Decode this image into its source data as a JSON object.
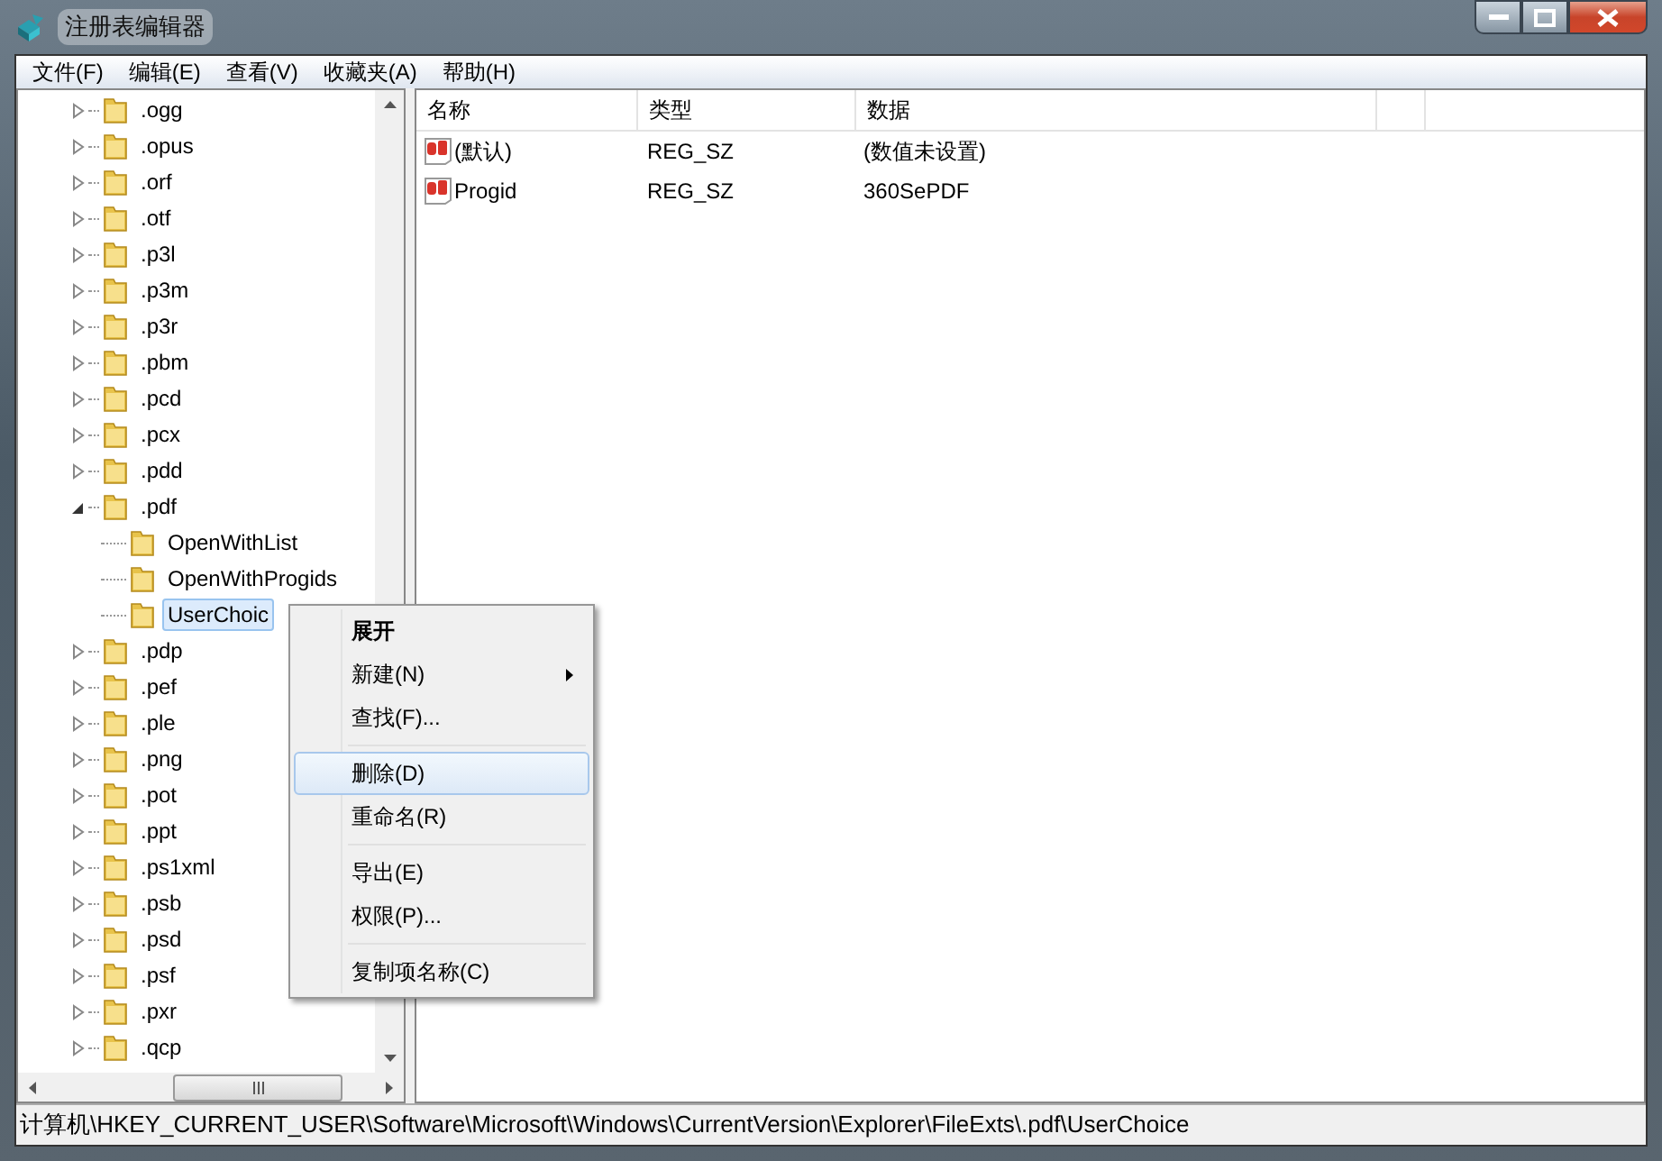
{
  "window": {
    "title": "注册表编辑器"
  },
  "menu_bar": [
    "文件(F)",
    "编辑(E)",
    "查看(V)",
    "收藏夹(A)",
    "帮助(H)"
  ],
  "tree": [
    {
      "label": ".ogg",
      "expanded": false,
      "selected": false
    },
    {
      "label": ".opus",
      "expanded": false,
      "selected": false
    },
    {
      "label": ".orf",
      "expanded": false,
      "selected": false
    },
    {
      "label": ".otf",
      "expanded": false,
      "selected": false
    },
    {
      "label": ".p3l",
      "expanded": false,
      "selected": false
    },
    {
      "label": ".p3m",
      "expanded": false,
      "selected": false
    },
    {
      "label": ".p3r",
      "expanded": false,
      "selected": false
    },
    {
      "label": ".pbm",
      "expanded": false,
      "selected": false
    },
    {
      "label": ".pcd",
      "expanded": false,
      "selected": false
    },
    {
      "label": ".pcx",
      "expanded": false,
      "selected": false
    },
    {
      "label": ".pdd",
      "expanded": false,
      "selected": false
    },
    {
      "label": ".pdf",
      "expanded": true,
      "selected": false,
      "children": [
        {
          "label": "OpenWithList",
          "selected": false
        },
        {
          "label": "OpenWithProgids",
          "selected": false
        },
        {
          "label": "UserChoic",
          "selected": true
        }
      ]
    },
    {
      "label": ".pdp",
      "expanded": false,
      "selected": false
    },
    {
      "label": ".pef",
      "expanded": false,
      "selected": false
    },
    {
      "label": ".ple",
      "expanded": false,
      "selected": false
    },
    {
      "label": ".png",
      "expanded": false,
      "selected": false
    },
    {
      "label": ".pot",
      "expanded": false,
      "selected": false
    },
    {
      "label": ".ppt",
      "expanded": false,
      "selected": false
    },
    {
      "label": ".ps1xml",
      "expanded": false,
      "selected": false
    },
    {
      "label": ".psb",
      "expanded": false,
      "selected": false
    },
    {
      "label": ".psd",
      "expanded": false,
      "selected": false
    },
    {
      "label": ".psf",
      "expanded": false,
      "selected": false
    },
    {
      "label": ".pxr",
      "expanded": false,
      "selected": false
    },
    {
      "label": ".qcp",
      "expanded": false,
      "selected": false
    }
  ],
  "values_table": {
    "columns": [
      "名称",
      "类型",
      "数据"
    ],
    "rows": [
      {
        "name": "(默认)",
        "type": "REG_SZ",
        "data": "(数值未设置)"
      },
      {
        "name": "Progid",
        "type": "REG_SZ",
        "data": "360SePDF"
      }
    ]
  },
  "context_menu": [
    {
      "kind": "item",
      "label": "展开",
      "default": true,
      "submenu": false,
      "selected": false
    },
    {
      "kind": "item",
      "label": "新建(N)",
      "default": false,
      "submenu": true,
      "selected": false
    },
    {
      "kind": "item",
      "label": "查找(F)...",
      "default": false,
      "submenu": false,
      "selected": false
    },
    {
      "kind": "separator"
    },
    {
      "kind": "item",
      "label": "删除(D)",
      "default": false,
      "submenu": false,
      "selected": true
    },
    {
      "kind": "item",
      "label": "重命名(R)",
      "default": false,
      "submenu": false,
      "selected": false
    },
    {
      "kind": "separator"
    },
    {
      "kind": "item",
      "label": "导出(E)",
      "default": false,
      "submenu": false,
      "selected": false
    },
    {
      "kind": "item",
      "label": "权限(P)...",
      "default": false,
      "submenu": false,
      "selected": false
    },
    {
      "kind": "separator"
    },
    {
      "kind": "item",
      "label": "复制项名称(C)",
      "default": false,
      "submenu": false,
      "selected": false
    }
  ],
  "status_bar": "计算机\\HKEY_CURRENT_USER\\Software\\Microsoft\\Windows\\CurrentVersion\\Explorer\\FileExts\\.pdf\\UserChoice"
}
